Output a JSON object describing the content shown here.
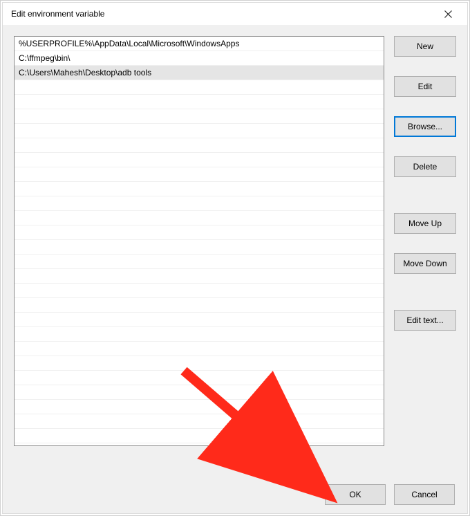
{
  "dialog": {
    "title": "Edit environment variable"
  },
  "list": {
    "rows_visible": 28,
    "items": [
      {
        "value": "%USERPROFILE%\\AppData\\Local\\Microsoft\\WindowsApps",
        "selected": false
      },
      {
        "value": "C:\\ffmpeg\\bin\\",
        "selected": false
      },
      {
        "value": "C:\\Users\\Mahesh\\Desktop\\adb tools",
        "selected": true
      }
    ]
  },
  "buttons": {
    "new": "New",
    "edit": "Edit",
    "browse": "Browse...",
    "delete": "Delete",
    "move_up": "Move Up",
    "move_down": "Move Down",
    "edit_text": "Edit text...",
    "ok": "OK",
    "cancel": "Cancel"
  },
  "annotation": {
    "arrow_color": "#ff2a1a",
    "arrow_target": "ok-button"
  }
}
